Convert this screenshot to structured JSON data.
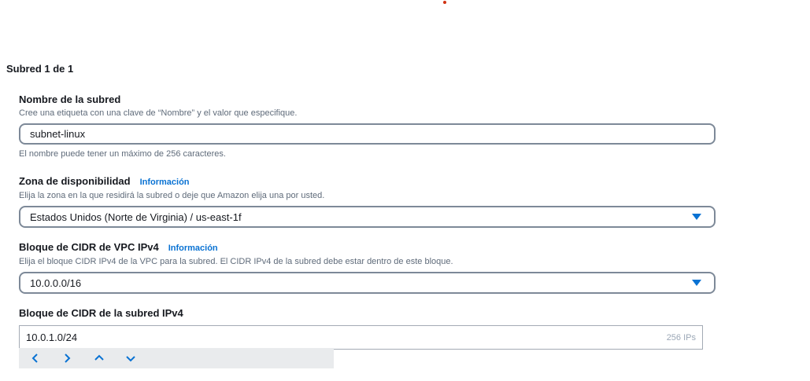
{
  "section": {
    "heading": "Subred 1 de 1"
  },
  "subnet_name": {
    "label": "Nombre de la subred",
    "description": "Cree una etiqueta con una clave de “Nombre” y el valor que especifique.",
    "value": "subnet-linux",
    "hint": "El nombre puede tener un máximo de 256 caracteres."
  },
  "availability_zone": {
    "label": "Zona de disponibilidad",
    "info_link": "Información",
    "description": "Elija la zona en la que residirá la subred o deje que Amazon elija una por usted.",
    "selected": "Estados Unidos (Norte de Virginia) / us-east-1f"
  },
  "vpc_cidr": {
    "label": "Bloque de CIDR de VPC IPv4",
    "info_link": "Información",
    "description": "Elija el bloque CIDR IPv4 de la VPC para la subred. El CIDR IPv4 de la subred debe estar dentro de este bloque.",
    "selected": "10.0.0.0/16"
  },
  "subnet_cidr": {
    "label": "Bloque de CIDR de la subred IPv4",
    "value": "10.0.1.0/24",
    "ip_count": "256 IPs"
  },
  "stepper": {
    "icons": [
      "chevron-left-icon",
      "chevron-right-icon",
      "chevron-up-icon",
      "chevron-down-icon"
    ]
  },
  "colors": {
    "accent": "#0972d3",
    "border": "#7d8998",
    "muted_text": "#5f6b7a",
    "stepper_bg": "#e9ebed"
  }
}
